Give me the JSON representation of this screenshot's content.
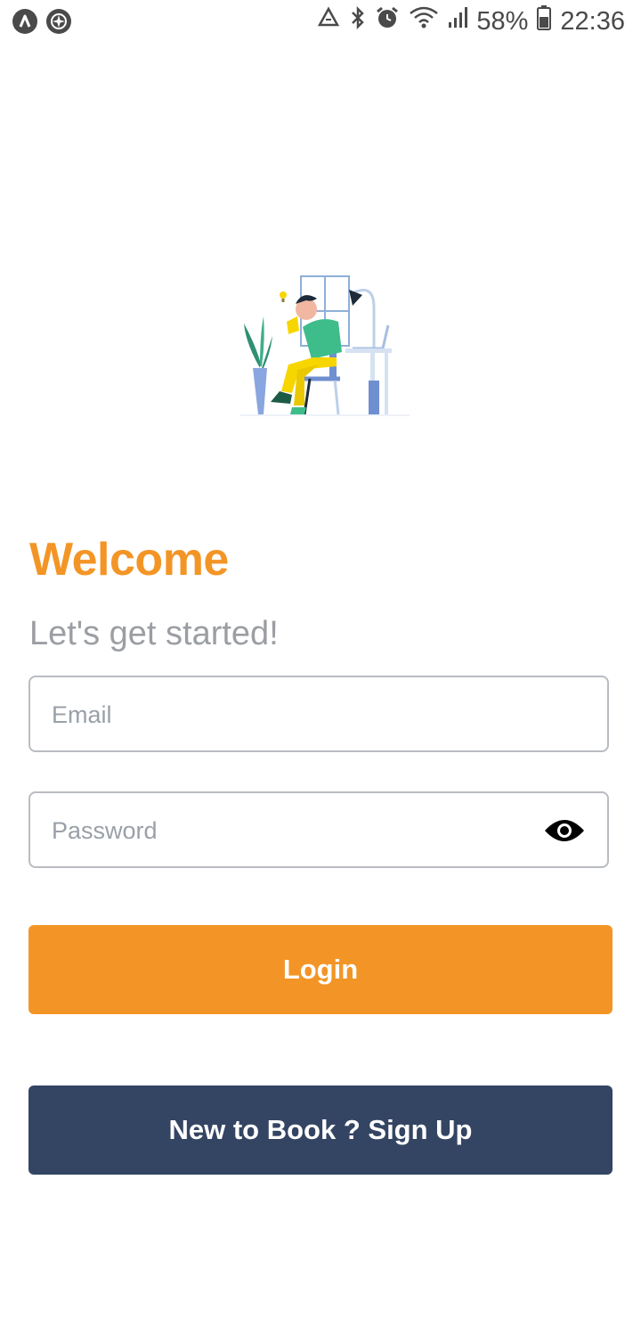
{
  "status_bar": {
    "battery": "58%",
    "time": "22:36",
    "icons": [
      "app-a-icon",
      "compass-icon",
      "recycle-icon",
      "bluetooth-icon",
      "alarm-icon",
      "wifi-icon",
      "signal-icon",
      "battery-icon"
    ]
  },
  "illustration": {
    "icon": "person-reading-illustration"
  },
  "header": {
    "title": "Welcome",
    "subtitle": "Let's get started!"
  },
  "form": {
    "email_placeholder": "Email",
    "password_placeholder": "Password",
    "toggle_icon": "eye-icon"
  },
  "actions": {
    "login_label": "Login",
    "signup_label": "New to Book ? Sign Up"
  },
  "colors": {
    "accent": "#F39526",
    "secondary": "#344563",
    "muted_text": "#9b9ea3"
  }
}
